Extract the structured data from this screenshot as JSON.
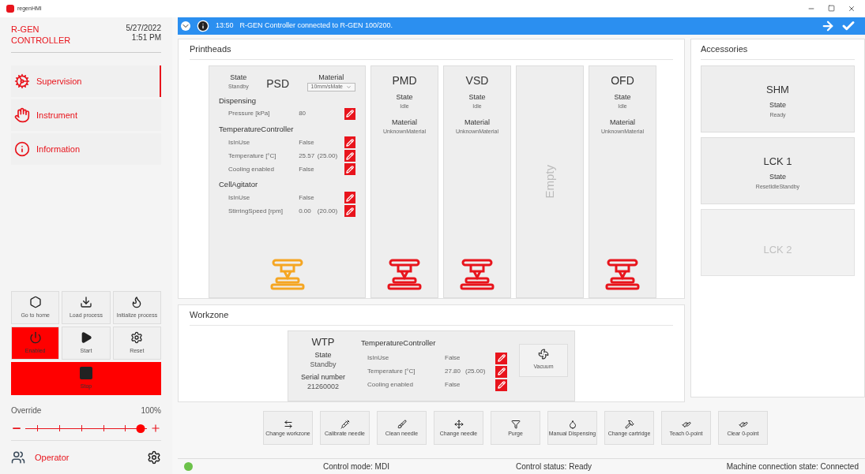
{
  "window": {
    "title": "regenHMI"
  },
  "sidebar": {
    "title": "R-GEN CONTROLLER",
    "date": "5/27/2022",
    "time": "1:51 PM",
    "nav": [
      {
        "label": "Supervision",
        "selected": true
      },
      {
        "label": "Instrument",
        "selected": false
      },
      {
        "label": "Information",
        "selected": false
      }
    ],
    "buttons": [
      {
        "label": "Go to home",
        "active": false
      },
      {
        "label": "Load process",
        "active": false
      },
      {
        "label": "Initialize process",
        "active": false
      },
      {
        "label": "Enabled",
        "active": true
      },
      {
        "label": "Start",
        "active": false
      },
      {
        "label": "Reset",
        "active": false
      }
    ],
    "stop": {
      "label": "Stop"
    },
    "override": {
      "label": "Override",
      "reading": "100%",
      "level": 0.95
    },
    "user": {
      "label": "Operator"
    }
  },
  "notification": {
    "time": "13:50",
    "message": "R-GEN Controller connected to R-GEN 100/200."
  },
  "printheads": {
    "title": "Printheads",
    "heads": [
      {
        "kind": "detailed",
        "name": "PSD",
        "state_label": "State",
        "state": "Standby",
        "material_label": "Material",
        "material": "10mm/sMate",
        "color": "#f5a623",
        "groups": [
          {
            "title": "Dispensing",
            "rows": [
              {
                "label": "Pressure [kPa]",
                "value": "80"
              }
            ]
          },
          {
            "title": "TemperatureController",
            "rows": [
              {
                "label": "IsInUse",
                "value": "False"
              },
              {
                "label": "Temperature [°C]",
                "value": "25.57",
                "target": "(25.00)"
              },
              {
                "label": "Cooling enabled",
                "value": "False"
              }
            ]
          },
          {
            "title": "CellAgitator",
            "rows": [
              {
                "label": "IsInUse",
                "value": "False"
              },
              {
                "label": "StirringSpeed [rpm]",
                "value": "0.00",
                "target": "(20.00)"
              }
            ]
          }
        ]
      },
      {
        "kind": "simple",
        "name": "PMD",
        "state_label": "State",
        "state": "Idle",
        "material_label": "Material",
        "material": "UnknownMaterial",
        "color": "#e8141c"
      },
      {
        "kind": "simple",
        "name": "VSD",
        "state_label": "State",
        "state": "Idle",
        "material_label": "Material",
        "material": "UnknownMaterial",
        "color": "#e8141c"
      },
      {
        "kind": "empty",
        "name": "Empty"
      },
      {
        "kind": "simple",
        "name": "OFD",
        "state_label": "State",
        "state": "Idle",
        "material_label": "Material",
        "material": "UnknownMaterial",
        "color": "#e8141c"
      }
    ]
  },
  "accessories": {
    "title": "Accessories",
    "items": [
      {
        "name": "SHM",
        "state_label": "State",
        "state": "Ready",
        "disabled": false
      },
      {
        "name": "LCK 1",
        "state_label": "State",
        "state": "ResetIdleStandby",
        "disabled": false
      },
      {
        "name": "LCK 2",
        "disabled": true
      }
    ]
  },
  "workzone": {
    "title": "Workzone",
    "name": "WTP",
    "state_label": "State",
    "state": "Standby",
    "serial_label": "Serial number",
    "serial": "21260002",
    "group": "TemperatureController",
    "rows": [
      {
        "label": "IsInUse",
        "value": "False"
      },
      {
        "label": "Temperature [°C]",
        "value": "27.80",
        "target": "(25.00)"
      },
      {
        "label": "Cooling enabled",
        "value": "False"
      }
    ],
    "vacuum": {
      "label": "Vacuum"
    }
  },
  "actions": [
    {
      "label": "Change workzone"
    },
    {
      "label": "Calibrate needle"
    },
    {
      "label": "Clean needle"
    },
    {
      "label": "Change needle"
    },
    {
      "label": "Purge"
    },
    {
      "label": "Manual Dispensing"
    },
    {
      "label": "Change cartridge"
    },
    {
      "label": "Teach 0-point"
    },
    {
      "label": "Clear 0-point"
    }
  ],
  "status_bar": {
    "connected": true,
    "control_mode": "Control mode: MDI",
    "control_status": "Control status: Ready",
    "connection": "Machine connection state: Connected"
  }
}
